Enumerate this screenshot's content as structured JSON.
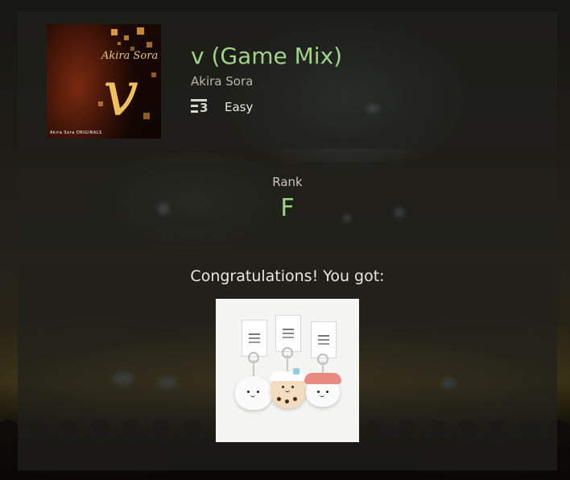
{
  "song": {
    "title": "v (Game Mix)",
    "artist": "Akira Sora",
    "difficulty_level": "3",
    "difficulty_label": "Easy",
    "album_art": {
      "title_text": "Akira Sora",
      "big_letter": "v",
      "footer_text": "Akira Sora ORIGINALS"
    }
  },
  "result": {
    "rank_label": "Rank",
    "rank_value": "F"
  },
  "reward": {
    "heading": "Congratulations! You got:"
  },
  "colors": {
    "accent_green": "#9fd38a",
    "panel_bg": "rgba(32,32,28,0.72)"
  }
}
